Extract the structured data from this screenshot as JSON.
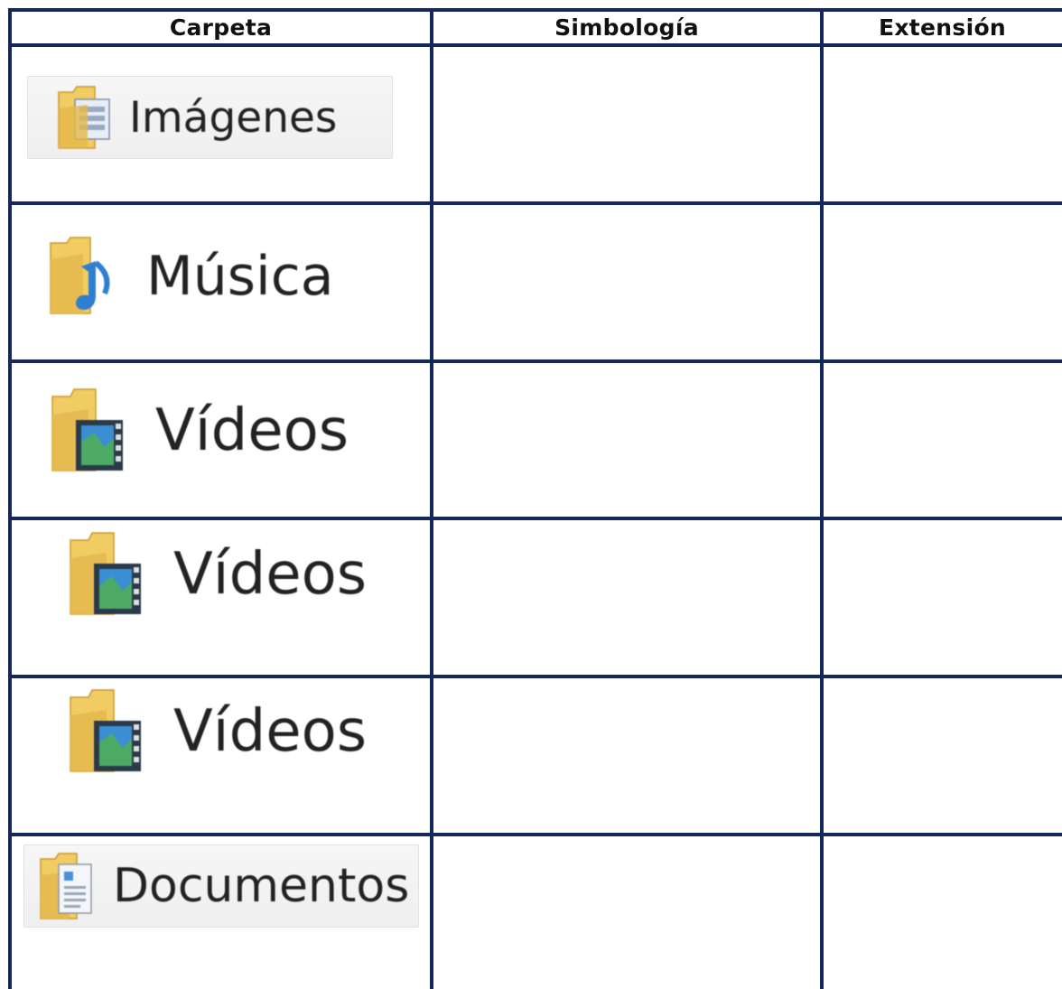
{
  "table": {
    "headers": {
      "folder": "Carpeta",
      "symbology": "Simbología",
      "extension": "Extensión"
    },
    "rows": [
      {
        "label": "Imágenes",
        "icon": "pictures-folder-icon",
        "symbology": "",
        "extension": ""
      },
      {
        "label": "Música",
        "icon": "music-folder-icon",
        "symbology": "",
        "extension": ""
      },
      {
        "label": "Vídeos",
        "icon": "videos-folder-icon",
        "symbology": "",
        "extension": ""
      },
      {
        "label": "Vídeos",
        "icon": "videos-folder-icon",
        "symbology": "",
        "extension": ""
      },
      {
        "label": "Vídeos",
        "icon": "videos-folder-icon",
        "symbology": "",
        "extension": ""
      },
      {
        "label": "Documentos",
        "icon": "documents-folder-icon",
        "symbology": "",
        "extension": ""
      }
    ]
  },
  "colors": {
    "grid": "#15285a",
    "folder": "#f1cc63",
    "music_note": "#2f7fd0"
  }
}
